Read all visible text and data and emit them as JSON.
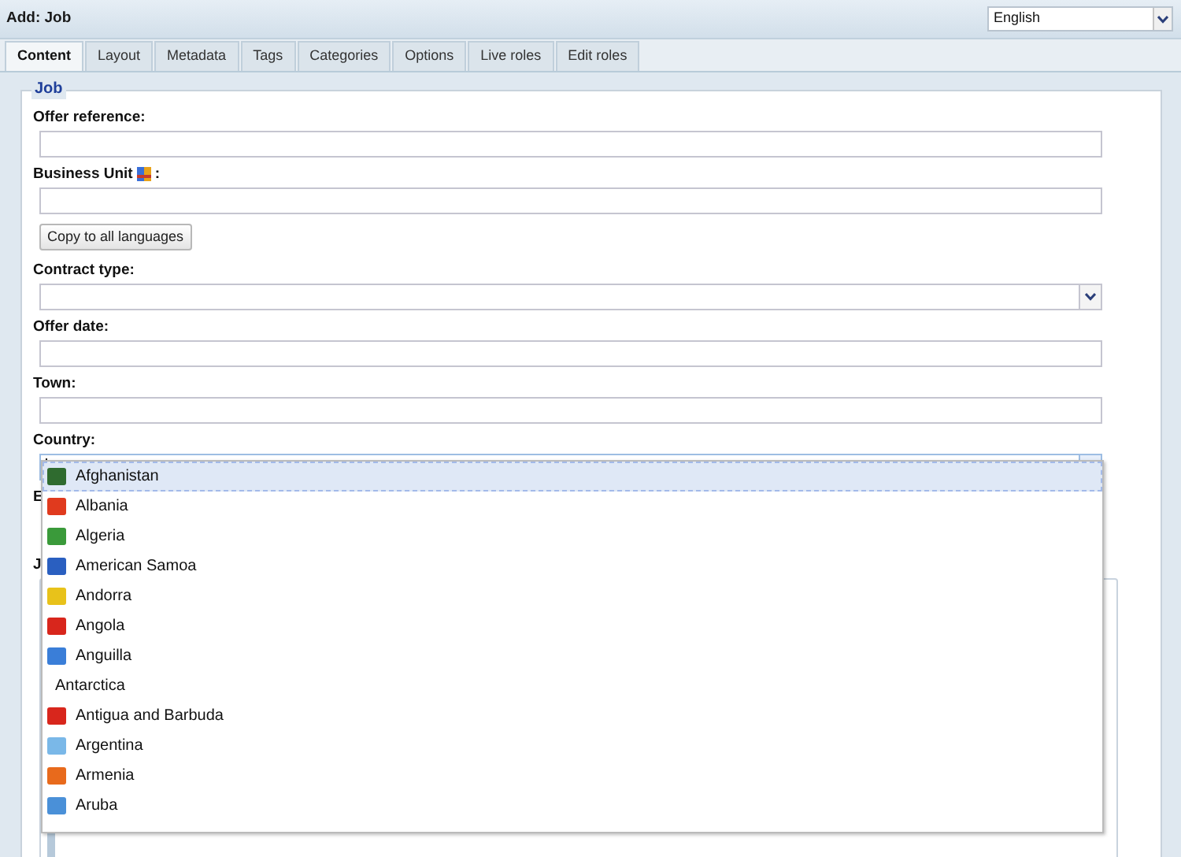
{
  "window": {
    "title": "Add: Job"
  },
  "language": {
    "value": "English"
  },
  "tabs": [
    {
      "label": "Content",
      "selected": true
    },
    {
      "label": "Layout",
      "selected": false
    },
    {
      "label": "Metadata",
      "selected": false
    },
    {
      "label": "Tags",
      "selected": false
    },
    {
      "label": "Categories",
      "selected": false
    },
    {
      "label": "Options",
      "selected": false
    },
    {
      "label": "Live roles",
      "selected": false
    },
    {
      "label": "Edit roles",
      "selected": false
    }
  ],
  "fieldset": {
    "legend": "Job"
  },
  "fields": [
    {
      "kind": "text",
      "label": "Offer reference:"
    },
    {
      "kind": "text",
      "label": "Business Unit",
      "has_icon": true,
      "suffix": ":",
      "button": "Copy to all languages"
    },
    {
      "kind": "select",
      "label": "Contract type:"
    },
    {
      "kind": "text",
      "label": "Offer date:"
    },
    {
      "kind": "text",
      "label": "Town:"
    },
    {
      "kind": "combo",
      "label": "Country:",
      "focused": true
    },
    {
      "kind": "covered",
      "label": "E"
    },
    {
      "kind": "editor",
      "label": "J"
    }
  ],
  "country_options": [
    {
      "kind": "flag",
      "label": "Afghanistan",
      "color": "#2f6b2f",
      "selected": true
    },
    {
      "kind": "flag",
      "label": "Albania",
      "color": "#e03a1e",
      "selected": false
    },
    {
      "kind": "flag",
      "label": "Algeria",
      "color": "#3a9a3a",
      "selected": false
    },
    {
      "kind": "flag",
      "label": "American Samoa",
      "color": "#2a5fc0",
      "selected": false
    },
    {
      "kind": "flag",
      "label": "Andorra",
      "color": "#e8c21a",
      "selected": false
    },
    {
      "kind": "flag",
      "label": "Angola",
      "color": "#d8261c",
      "selected": false
    },
    {
      "kind": "flag",
      "label": "Anguilla",
      "color": "#3a7ed8",
      "selected": false
    },
    {
      "kind": "plain",
      "label": "Antarctica",
      "selected": false
    },
    {
      "kind": "flag",
      "label": "Antigua and Barbuda",
      "color": "#d8261c",
      "selected": false
    },
    {
      "kind": "flag",
      "label": "Argentina",
      "color": "#7ab8e8",
      "selected": false
    },
    {
      "kind": "flag",
      "label": "Armenia",
      "color": "#e86a1c",
      "selected": false
    },
    {
      "kind": "flag",
      "label": "Aruba",
      "color": "#4a90d8",
      "selected": false
    }
  ]
}
